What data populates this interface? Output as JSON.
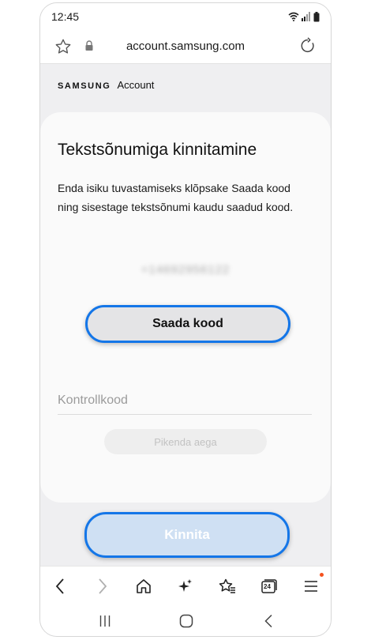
{
  "status_bar": {
    "time": "12:45"
  },
  "url_bar": {
    "url": "account.samsung.com"
  },
  "brand": {
    "logo": "SAMSUNG",
    "label": "Account"
  },
  "card": {
    "title": "Tekstsõnumiga kinnitamine",
    "description": "Enda isiku tuvastamiseks klõpsake Saada kood ning sisestage tekstsõnumi kaudu saadud kood.",
    "phone_number": "+14692956122",
    "send_code_label": "Saada kood",
    "code_placeholder": "Kontrollkood",
    "extend_time_label": "Pikenda aega"
  },
  "confirm_label": "Kinnita",
  "toolbar": {
    "tabs_count": "24"
  },
  "colors": {
    "accent": "#1476e8",
    "confirm_bg": "#cfe0f3",
    "notification_dot": "#f4511e"
  }
}
